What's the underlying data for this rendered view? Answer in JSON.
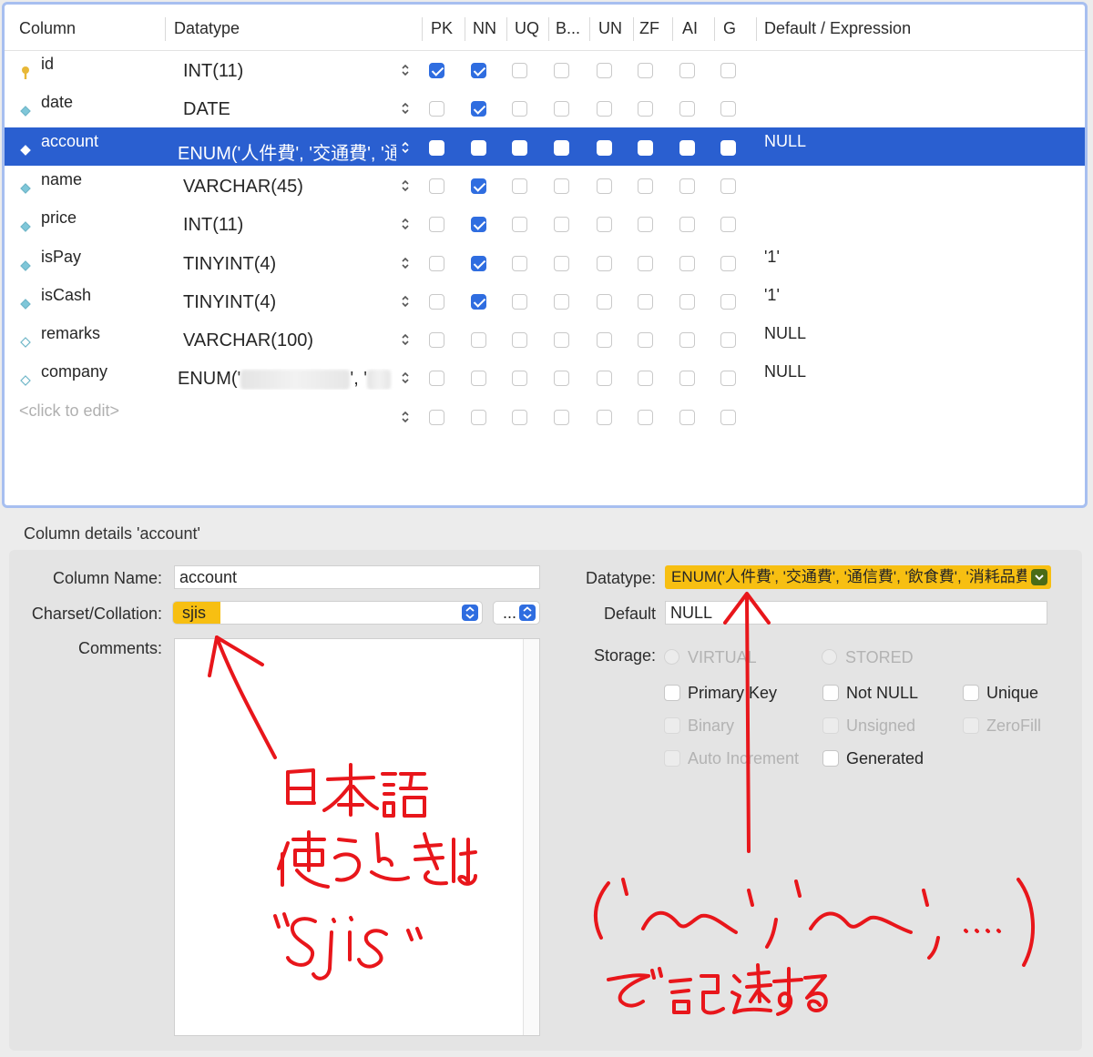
{
  "table": {
    "headers": [
      "Column",
      "Datatype",
      "PK",
      "NN",
      "UQ",
      "B...",
      "UN",
      "ZF",
      "AI",
      "G",
      "Default / Expression"
    ],
    "rows": [
      {
        "name": "id",
        "type": "INT(11)",
        "icon": "key-icon",
        "flags": [
          true,
          true,
          false,
          false,
          false,
          false,
          false,
          false
        ],
        "default": ""
      },
      {
        "name": "date",
        "type": "DATE",
        "icon": "diamond-icon",
        "flags": [
          false,
          true,
          false,
          false,
          false,
          false,
          false,
          false
        ],
        "default": ""
      },
      {
        "name": "account",
        "type": "ENUM('人件費', '交通費', '通信費', '飲食費', '消耗品費')",
        "icon": "diamond-icon",
        "flags": [
          false,
          false,
          false,
          false,
          false,
          false,
          false,
          false
        ],
        "default": "NULL",
        "selected": true
      },
      {
        "name": "name",
        "type": "VARCHAR(45)",
        "icon": "diamond-icon",
        "flags": [
          false,
          true,
          false,
          false,
          false,
          false,
          false,
          false
        ],
        "default": ""
      },
      {
        "name": "price",
        "type": "INT(11)",
        "icon": "diamond-icon",
        "flags": [
          false,
          true,
          false,
          false,
          false,
          false,
          false,
          false
        ],
        "default": ""
      },
      {
        "name": "isPay",
        "type": "TINYINT(4)",
        "icon": "diamond-icon",
        "flags": [
          false,
          true,
          false,
          false,
          false,
          false,
          false,
          false
        ],
        "default": "'1'"
      },
      {
        "name": "isCash",
        "type": "TINYINT(4)",
        "icon": "diamond-icon",
        "flags": [
          false,
          true,
          false,
          false,
          false,
          false,
          false,
          false
        ],
        "default": "'1'"
      },
      {
        "name": "remarks",
        "type": "VARCHAR(100)",
        "icon": "diamond-outline-icon",
        "flags": [
          false,
          false,
          false,
          false,
          false,
          false,
          false,
          false
        ],
        "default": "NULL"
      },
      {
        "name": "company",
        "type": "ENUM('",
        "type_mid": "', '",
        "icon": "diamond-outline-icon",
        "flags": [
          false,
          false,
          false,
          false,
          false,
          false,
          false,
          false
        ],
        "default": "NULL",
        "redacted": true
      }
    ],
    "new_row_placeholder": "<click to edit>"
  },
  "details": {
    "title": "Column details 'account'",
    "column_name_label": "Column Name:",
    "column_name_value": "account",
    "charset_label": "Charset/Collation:",
    "charset_value": "sjis",
    "collation_value": "...",
    "comments_label": "Comments:",
    "datatype_label": "Datatype:",
    "datatype_value": "ENUM('人件費', '交通費', '通信費', '飲食費', '消耗品費')",
    "default_label": "Default",
    "default_value": "NULL",
    "storage_label": "Storage:",
    "storage_options": [
      "VIRTUAL",
      "STORED"
    ],
    "checkboxes": {
      "primary_key": "Primary Key",
      "not_null": "Not NULL",
      "unique": "Unique",
      "binary": "Binary",
      "unsigned": "Unsigned",
      "zerofill": "ZeroFill",
      "auto_increment": "Auto Increment",
      "generated": "Generated"
    }
  },
  "annotations": {
    "color": "#e8161b",
    "highlight_color": "#f7bf12",
    "left_note": "日本語 使うときは “sjis”",
    "right_note": "で記述する",
    "right_example": "('〜', '〜', ....)"
  }
}
